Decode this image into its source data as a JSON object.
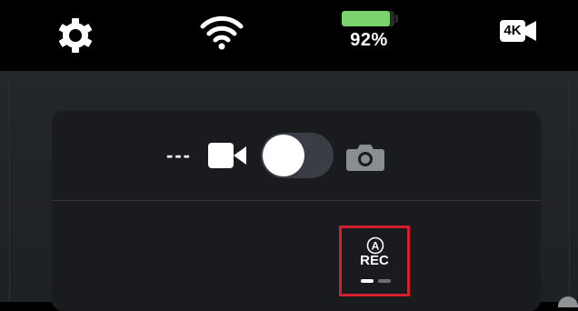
{
  "status_bar": {
    "settings_icon": "gear-icon",
    "wifi_icon": "wifi-icon",
    "battery": {
      "label": "92%",
      "level_percent": 92,
      "fill_color": "#7ad36c"
    },
    "resolution_label": "4K",
    "resolution_icon": "video-camera-4k-icon"
  },
  "mode_switch": {
    "placeholder_text": "---",
    "video_icon": "video-camera-icon",
    "photo_icon": "camera-icon",
    "selected": "video"
  },
  "record_button": {
    "auto_icon": "auto-a-icon",
    "auto_letter": "A",
    "label": "REC",
    "highlight_color": "#d61f2c"
  },
  "pager": {
    "active_index": 0,
    "count": 2
  }
}
